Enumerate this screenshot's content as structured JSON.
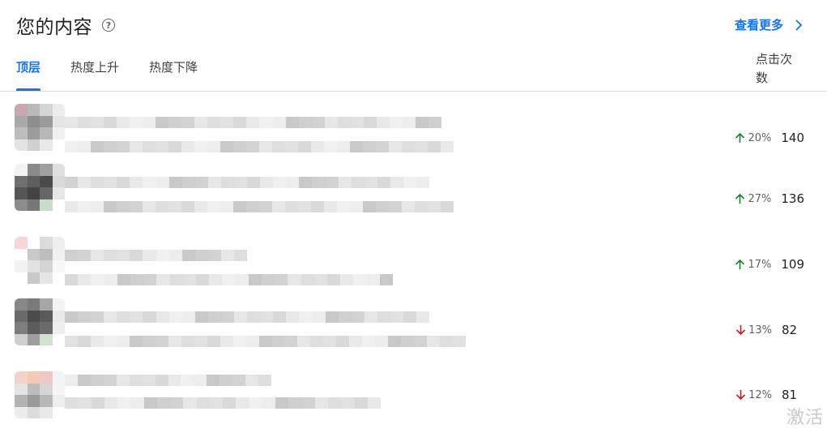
{
  "header": {
    "title": "您的内容",
    "see_more_label": "查看更多"
  },
  "tabs": [
    {
      "label": "顶层",
      "active": true
    },
    {
      "label": "热度上升",
      "active": false
    },
    {
      "label": "热度下降",
      "active": false
    }
  ],
  "column_header": "点击次数",
  "rows": [
    {
      "direction": "up",
      "change": "20%",
      "clicks": "140"
    },
    {
      "direction": "up",
      "change": "27%",
      "clicks": "136"
    },
    {
      "direction": "up",
      "change": "17%",
      "clicks": "109"
    },
    {
      "direction": "down",
      "change": "13%",
      "clicks": "82"
    },
    {
      "direction": "down",
      "change": "12%",
      "clicks": "81"
    }
  ],
  "colors": {
    "accent": "#1a73e8",
    "up": "#188038",
    "down": "#c5221f",
    "text": "#202124",
    "muted": "#5f6368"
  },
  "watermark": "激活"
}
